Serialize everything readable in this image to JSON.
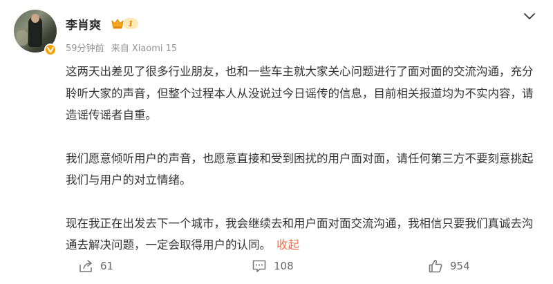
{
  "post": {
    "author": "李肖爽",
    "level": "1",
    "time": "59分钟前",
    "source": "来自 Xiaomi 15",
    "paragraphs": [
      "这两天出差见了很多行业朋友，也和一些车主就大家关心问题进行了面对面的交流沟通，充分聆听大家的声音，但整个过程本人从没说过今日谣传的信息，目前相关报道均为不实内容，请造谣传谣者自重。",
      "我们愿意倾听用户的声音，也愿意直接和受到困扰的用户面对面，请任何第三方不要刻意挑起我们与用户的对立情绪。",
      "现在我正在出发去下一个城市，我会继续去和用户面对面交流沟通，我相信只要我们真诚去沟通去解决问题，一定会取得用户的认同。"
    ],
    "collapse_label": "收起"
  },
  "actions": {
    "share_count": "61",
    "comment_count": "108",
    "like_count": "954"
  },
  "icons": {
    "verified": "verified-v-icon",
    "level": "crown-icon",
    "more": "chevron-down-icon",
    "share": "share-icon",
    "comment": "comment-icon",
    "like": "thumbs-up-icon"
  },
  "colors": {
    "accent": "#eb7350",
    "verified": "#f7a200",
    "meta": "#939393"
  }
}
